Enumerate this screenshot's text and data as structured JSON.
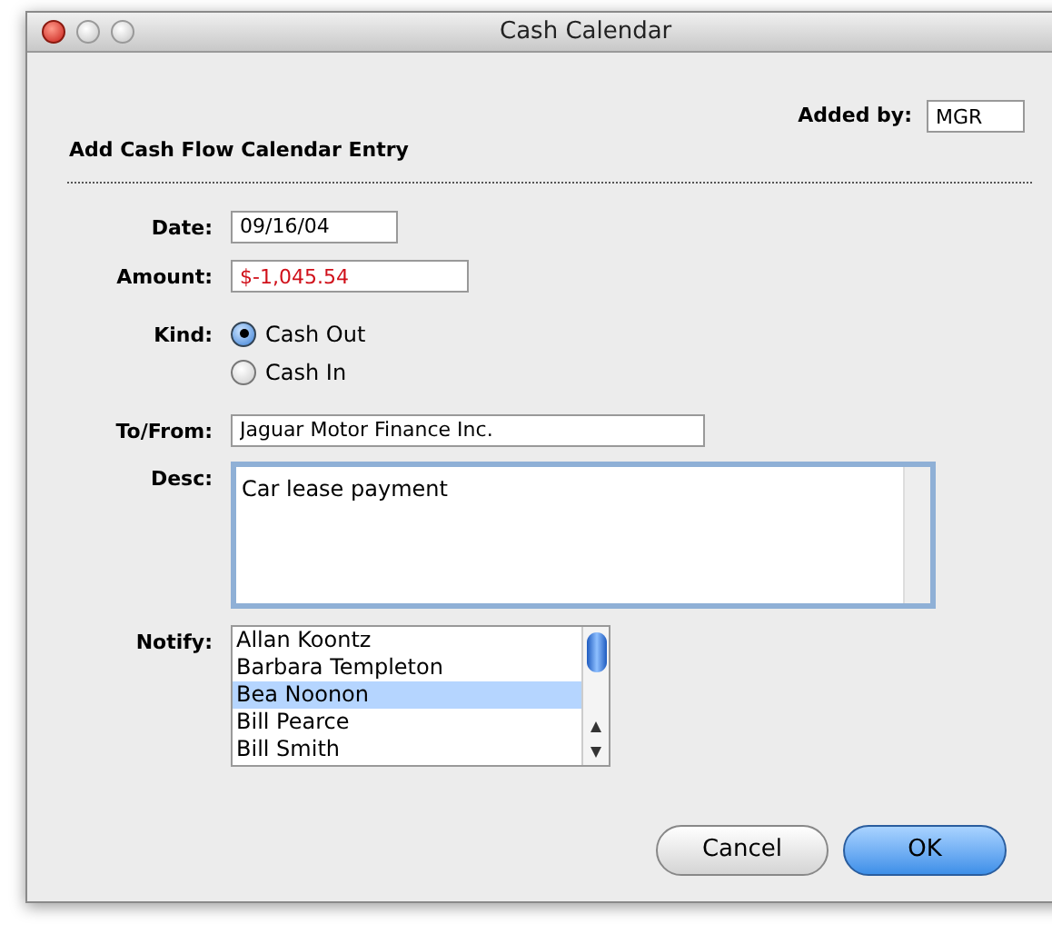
{
  "window": {
    "title": "Cash Calendar"
  },
  "added_by": {
    "label": "Added by:",
    "value": "MGR"
  },
  "heading": "Add Cash Flow Calendar Entry",
  "date": {
    "label": "Date:",
    "value": "09/16/04"
  },
  "amount": {
    "label": "Amount:",
    "value": "$-1,045.54"
  },
  "kind": {
    "label": "Kind:",
    "options": [
      {
        "label": "Cash Out",
        "selected": true
      },
      {
        "label": "Cash In",
        "selected": false
      }
    ]
  },
  "to_from": {
    "label": "To/From:",
    "value": "Jaguar Motor Finance Inc."
  },
  "desc": {
    "label": "Desc:",
    "value": "Car lease payment",
    "focused": true
  },
  "notify": {
    "label": "Notify:",
    "items": [
      {
        "label": "Allan Koontz",
        "selected": false
      },
      {
        "label": "Barbara Templeton",
        "selected": false
      },
      {
        "label": "Bea Noonon",
        "selected": true
      },
      {
        "label": "Bill Pearce",
        "selected": false
      },
      {
        "label": "Bill Smith",
        "selected": false
      }
    ]
  },
  "buttons": [
    {
      "label": "Cancel",
      "default": false
    },
    {
      "label": "OK",
      "default": true
    }
  ]
}
